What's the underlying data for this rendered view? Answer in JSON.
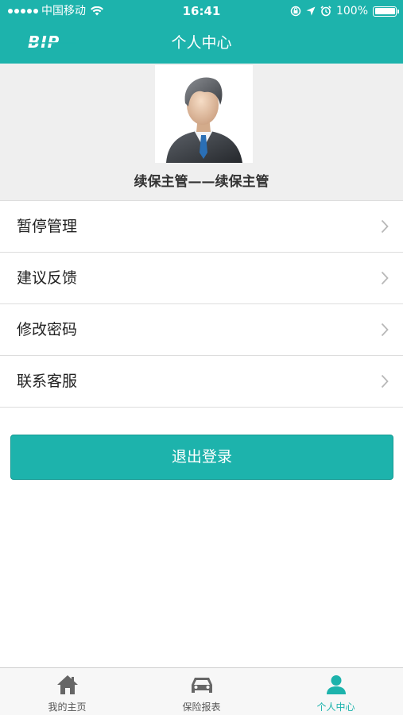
{
  "status_bar": {
    "carrier": "中国移动",
    "time": "16:41",
    "battery": "100%"
  },
  "nav": {
    "logo_text": "BIP",
    "title": "个人中心"
  },
  "profile": {
    "name": "续保主管——续保主管"
  },
  "menu": {
    "items": [
      {
        "label": "暂停管理"
      },
      {
        "label": "建议反馈"
      },
      {
        "label": "修改密码"
      },
      {
        "label": "联系客服"
      }
    ]
  },
  "logout": {
    "label": "退出登录"
  },
  "tabs": [
    {
      "label": "我的主页",
      "icon": "home-icon",
      "active": false
    },
    {
      "label": "保险报表",
      "icon": "car-icon",
      "active": false
    },
    {
      "label": "个人中心",
      "icon": "person-icon",
      "active": true
    }
  ],
  "colors": {
    "accent": "#1db3ac",
    "profile_bg": "#efefef",
    "tab_inactive": "#555555"
  }
}
